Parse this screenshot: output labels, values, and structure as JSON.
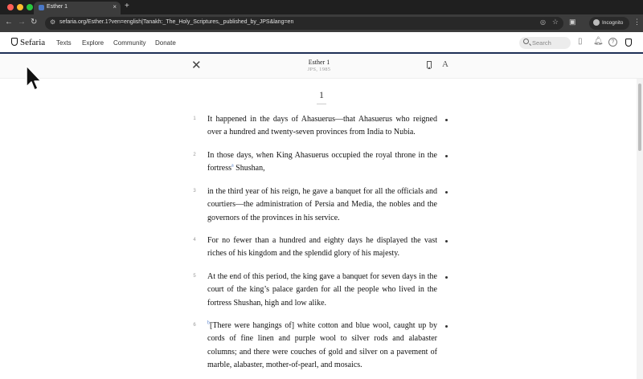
{
  "browser": {
    "tab_title": "Esther 1",
    "tab_close": "×",
    "new_tab": "+",
    "url": "sefaria.org/Esther.1?ven=english|Tanakh:_The_Holy_Scriptures,_published_by_JPS&lang=en",
    "incognito_label": "Incognito"
  },
  "site": {
    "logo": "Sefaria",
    "nav": [
      "Texts",
      "Explore",
      "Community",
      "Donate"
    ],
    "search_placeholder": "Search",
    "help_glyph": "?"
  },
  "reader": {
    "close_glyph": "✕",
    "book_title": "Esther 1",
    "version": "JPS, 1985",
    "font_glyph": "A",
    "chapter": "1"
  },
  "verses": [
    {
      "num": "1",
      "text": "It happened in the days of Ahasuerus—that Ahasuerus who reigned over a hundred and twenty-seven provinces from India to Nubia."
    },
    {
      "num": "2",
      "text_before": "In those days, when King Ahasuerus occupied the royal throne in the fortress",
      "footnote": "a",
      "text_after": " Shushan,"
    },
    {
      "num": "3",
      "text": "in the third year of his reign, he gave a banquet for all the officials and courtiers—the administration of Persia and Media, the nobles and the governors of the provinces in his service."
    },
    {
      "num": "4",
      "text": "For no fewer than a hundred and eighty days he displayed the vast riches of his kingdom and the splendid glory of his majesty."
    },
    {
      "num": "5",
      "text": "At the end of this period, the king gave a banquet for seven days in the court of the king’s palace garden for all the people who lived in the fortress Shushan, high and low alike."
    },
    {
      "num": "6",
      "footnote": "b",
      "text_after": "[There were hangings of] white cotton and blue wool, caught up by cords of fine linen and purple wool to silver rods and alabaster columns; and there were couches of gold and silver on a pavement of marble, alabaster, mother-of-pearl, and mosaics."
    }
  ]
}
